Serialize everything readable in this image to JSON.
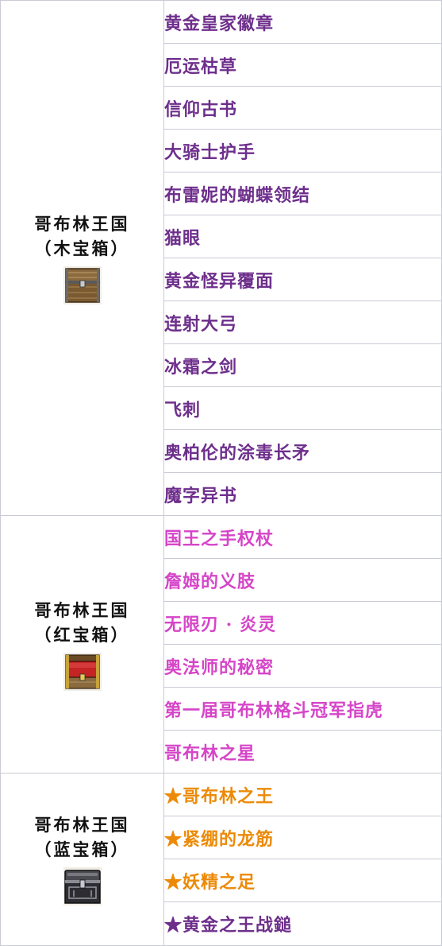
{
  "groups": [
    {
      "name_line1": "哥布林王国",
      "name_line2": "（木宝箱）",
      "chest_icon": "wooden-chest-icon",
      "color": "#6e2f8c",
      "items": [
        "黄金皇家徽章",
        "厄运枯草",
        "信仰古书",
        "大骑士护手",
        "布雷妮的蝴蝶领结",
        "猫眼",
        "黄金怪异覆面",
        "连射大弓",
        "冰霜之剑",
        "飞刺",
        "奥柏伦的涂毒长矛",
        "魔字异书"
      ]
    },
    {
      "name_line1": "哥布林王国",
      "name_line2": "（红宝箱）",
      "chest_icon": "red-chest-icon",
      "color": "#d645c8",
      "items": [
        "国王之手权杖",
        "詹姆的义肢",
        "无限刃 · 炎灵",
        "奥法师的秘密",
        "第一届哥布林格斗冠军指虎",
        "哥布林之星"
      ]
    },
    {
      "name_line1": "哥布林王国",
      "name_line2": "（蓝宝箱）",
      "chest_icon": "blue-chest-icon",
      "items": [
        {
          "label": "★哥布林之王",
          "color": "#ec8a07"
        },
        {
          "label": "★紧绷的龙筋",
          "color": "#ec8a07"
        },
        {
          "label": "★妖精之足",
          "color": "#ec8a07"
        },
        {
          "label": "★黄金之王战鎚",
          "color": "#6e2f8c"
        }
      ]
    }
  ]
}
